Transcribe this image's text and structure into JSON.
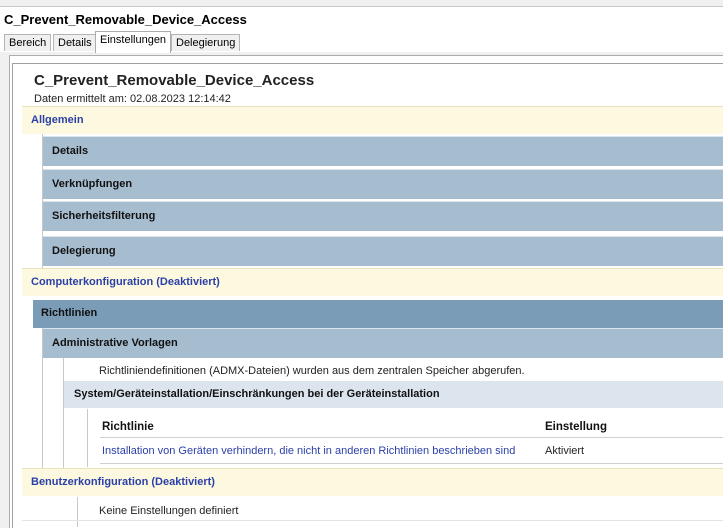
{
  "title": "C_Prevent_Removable_Device_Access",
  "tabs": [
    "Bereich",
    "Details",
    "Einstellungen",
    "Delegierung"
  ],
  "active_tab": "Einstellungen",
  "report": {
    "gpo_name": "C_Prevent_Removable_Device_Access",
    "date_line": "Daten ermittelt am: 02.08.2023 12:14:42",
    "allgemein": "Allgemein",
    "sub_sections": [
      "Details",
      "Verknüpfungen",
      "Sicherheitsfilterung",
      "Delegierung"
    ],
    "computer_config": "Computerkonfiguration (Deaktiviert)",
    "richtlinien": "Richtlinien",
    "admin_vorlagen": "Administrative Vorlagen",
    "admx_note": "Richtliniendefinitionen (ADMX-Dateien) wurden aus dem zentralen Speicher abgerufen.",
    "category": "System/Geräteinstallation/Einschränkungen bei der Geräteinstallation",
    "table": {
      "headers": [
        "Richtlinie",
        "Einstellung"
      ],
      "rows": [
        {
          "policy": "Installation von Geräten verhindern, die nicht in anderen Richtlinien beschrieben sind",
          "setting": "Aktiviert"
        }
      ]
    },
    "user_config": "Benutzerkonfiguration (Deaktiviert)",
    "no_settings": "Keine Einstellungen definiert"
  }
}
